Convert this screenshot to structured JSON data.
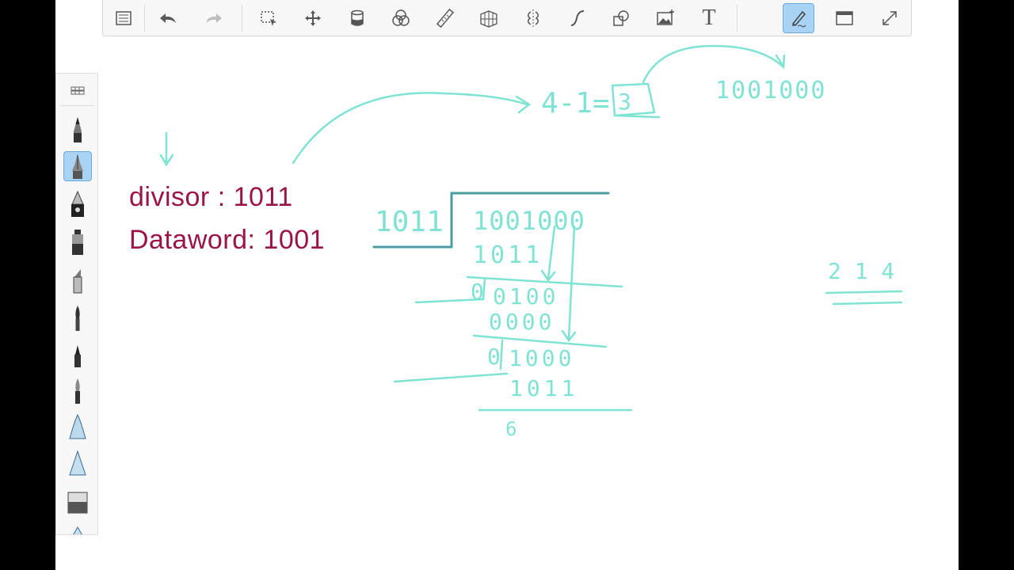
{
  "toolbar": {
    "items": [
      {
        "id": "list",
        "icon": "list-icon"
      },
      {
        "id": "undo",
        "icon": "undo-arrow-icon"
      },
      {
        "id": "redo",
        "icon": "redo-arrow-icon"
      },
      {
        "id": "select",
        "icon": "selection-tool-icon"
      },
      {
        "id": "move",
        "icon": "move-icon"
      },
      {
        "id": "fill",
        "icon": "paint-bucket-icon"
      },
      {
        "id": "color",
        "icon": "color-wheel-icon"
      },
      {
        "id": "ruler",
        "icon": "ruler-icon"
      },
      {
        "id": "perspective",
        "icon": "perspective-grid-icon"
      },
      {
        "id": "symmetry",
        "icon": "symmetry-icon"
      },
      {
        "id": "curve",
        "icon": "curve-icon"
      },
      {
        "id": "shapes",
        "icon": "shapes-icon"
      },
      {
        "id": "image",
        "icon": "insert-image-icon"
      },
      {
        "id": "text",
        "icon": "text-tool-icon"
      },
      {
        "id": "brush",
        "icon": "brush-tool-icon",
        "active": true
      },
      {
        "id": "window",
        "icon": "window-icon"
      },
      {
        "id": "fullscreen",
        "icon": "fullscreen-icon"
      }
    ],
    "text_glyph": "T"
  },
  "brushbar": {
    "items": [
      "pencil",
      "ballpoint",
      "fountain-pen",
      "marker",
      "chisel-marker",
      "brush",
      "fine-pen",
      "paintbrush",
      "airbrush-cone",
      "soft-cone",
      "eraser",
      "extra-cone"
    ],
    "active_index": 1
  },
  "canvas": {
    "divisor_line": "divisor : 1011",
    "dataword_line": "Dataword: 1001",
    "ink_color": "#7fe3d3",
    "text_color": "#9a1448"
  },
  "handwriting": {
    "degree_expr": "4-1=",
    "degree_result": "3",
    "augmented": "1001000",
    "divisor": "1011",
    "dividend": "1001000",
    "step1_sub": "1011",
    "step1_rem_lead": "0",
    "step1_rem": "0100",
    "step2_sub": "0000",
    "step2_rem_lead": "0",
    "step2_rem": "1000",
    "step3_sub": "1011",
    "final": "6",
    "side_note": "2 1 4"
  }
}
